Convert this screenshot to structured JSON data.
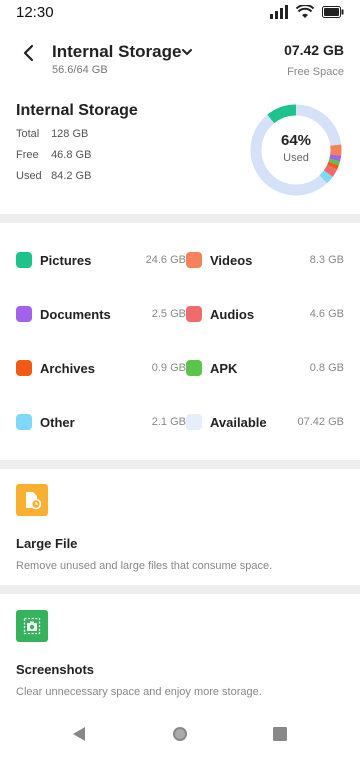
{
  "status_bar": {
    "time": "12:30"
  },
  "header": {
    "title": "Internal Storage",
    "subtitle": "56.6/64 GB",
    "free_value": "07.42 GB",
    "free_label": "Free Space"
  },
  "summary": {
    "title": "Internal Storage",
    "total_label": "Total",
    "total_value": "128 GB",
    "free_label": "Free",
    "free_value": "46.8 GB",
    "used_label": "Used",
    "used_value": "84.2 GB",
    "used_percent_text": "64%",
    "used_percent": 64,
    "used_caption": "Used"
  },
  "categories": [
    {
      "name": "Pictures",
      "size": "24.6 GB",
      "color": "#1ec28b"
    },
    {
      "name": "Videos",
      "size": "8.3 GB",
      "color": "#f5825a"
    },
    {
      "name": "Documents",
      "size": "2.5 GB",
      "color": "#a063ea"
    },
    {
      "name": "Audios",
      "size": "4.6 GB",
      "color": "#f26b6b"
    },
    {
      "name": "Archives",
      "size": "0.9 GB",
      "color": "#f15a16"
    },
    {
      "name": "APK",
      "size": "0.8 GB",
      "color": "#5bc44a"
    },
    {
      "name": "Other",
      "size": "2.1 GB",
      "color": "#7dd9f5"
    },
    {
      "name": "Available",
      "size": "07.42 GB",
      "color": "#e6eefc"
    }
  ],
  "features": [
    {
      "title": "Large File",
      "desc": "Remove unused and large files that consume space.",
      "icon": "large-file-icon",
      "color": "#f9b030"
    },
    {
      "title": "Screenshots",
      "desc": "Clear unnecessary space and enjoy more storage.",
      "icon": "screenshot-icon",
      "color": "#34b35a"
    }
  ],
  "colors": {
    "donut_track": "#d4e1f7",
    "donut_used": "#1ec28b"
  }
}
